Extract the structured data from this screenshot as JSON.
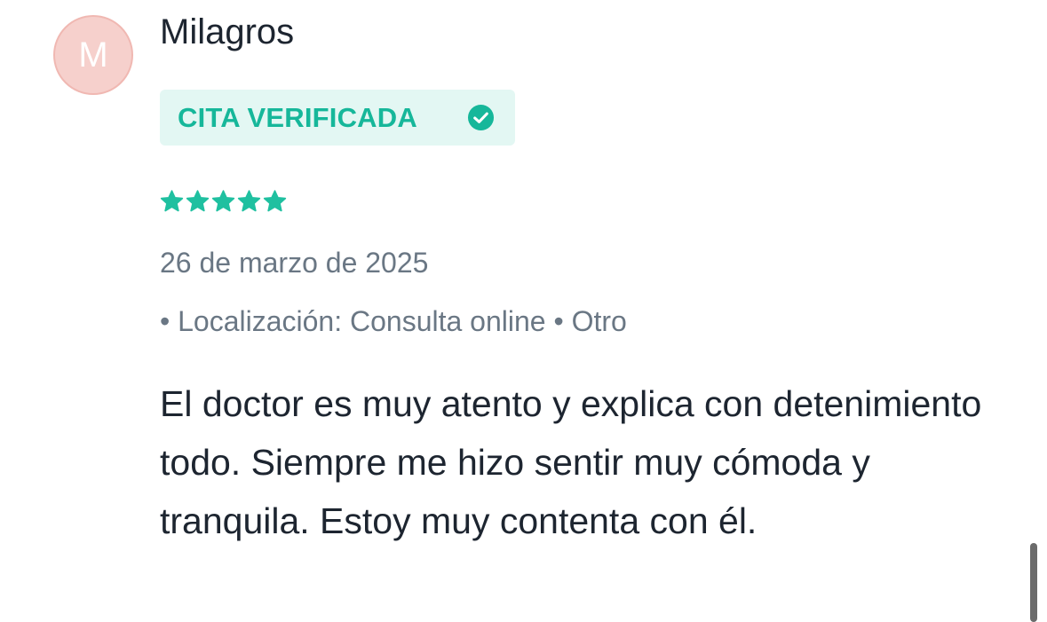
{
  "review": {
    "avatar_initial": "M",
    "author": "Milagros",
    "badge": {
      "label": "CITA VERIFICADA",
      "icon": "check-circle-icon",
      "color": "#16b79a",
      "background": "#e3f7f3"
    },
    "rating": 5,
    "rating_max": 5,
    "star_color": "#1fc0a0",
    "date": "26 de marzo de 2025",
    "meta": "• Localización: Consulta online • Otro",
    "comment": "El doctor es muy atento y explica con detenimiento todo. Siempre me hizo sentir muy cómoda y tranquila. Estoy muy contenta con él."
  }
}
